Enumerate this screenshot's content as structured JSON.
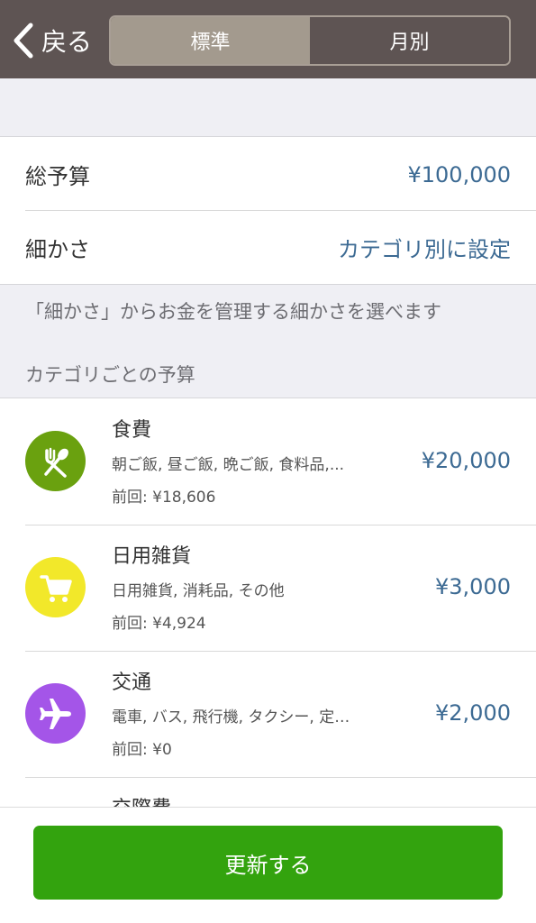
{
  "header": {
    "back_label": "戻る",
    "tabs": [
      {
        "label": "標準",
        "active": true
      },
      {
        "label": "月別",
        "active": false
      }
    ]
  },
  "budget": {
    "total_label": "総予算",
    "total_value": "¥100,000",
    "granularity_label": "細かさ",
    "granularity_value": "カテゴリ別に設定"
  },
  "hint": "「細かさ」からお金を管理する細かさを選べます",
  "section_title": "カテゴリごとの予算",
  "categories": [
    {
      "name": "食費",
      "subs": "朝ご飯, 昼ご飯, 晩ご飯, 食料品,...",
      "prev": "前回: ¥18,606",
      "amount": "¥20,000",
      "icon": "fork-spoon-icon",
      "color": "#6aa10f"
    },
    {
      "name": "日用雑貨",
      "subs": "日用雑貨, 消耗品, その他",
      "prev": "前回: ¥4,924",
      "amount": "¥3,000",
      "icon": "cart-icon",
      "color": "#f2e82a"
    },
    {
      "name": "交通",
      "subs": "電車, バス, 飛行機, タクシー, 定…",
      "prev": "前回: ¥0",
      "amount": "¥2,000",
      "icon": "airplane-icon",
      "color": "#a455e8"
    },
    {
      "name": "交際費"
    }
  ],
  "footer": {
    "update_label": "更新する"
  },
  "colors": {
    "header_bg": "#5e5453",
    "link_blue": "#3c6a93",
    "button_green": "#33a30e"
  }
}
